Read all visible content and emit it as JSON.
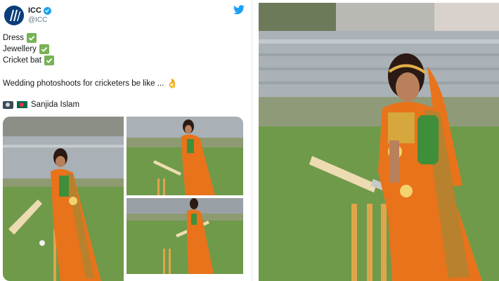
{
  "tweet": {
    "display_name": "ICC",
    "handle": "@ICC",
    "lines": [
      "Dress",
      "Jewellery",
      "Cricket bat"
    ],
    "caption": "Wedding photoshoots for cricketers be like ...",
    "mention": "Sanjida Islam",
    "icons": {
      "avatar": "icc-logo-icon",
      "verified": "verified-badge-icon",
      "brand": "twitter-bird-icon",
      "check": "check-mark-icon",
      "emoji": "ok-hand-icon",
      "tag": "camera-icon",
      "flag": "bangladesh-flag-icon"
    }
  },
  "colors": {
    "twitter_blue": "#1da1f2",
    "check_green": "#77b255",
    "saree_orange": "#e8731b",
    "grass": "#6f9a4a"
  }
}
